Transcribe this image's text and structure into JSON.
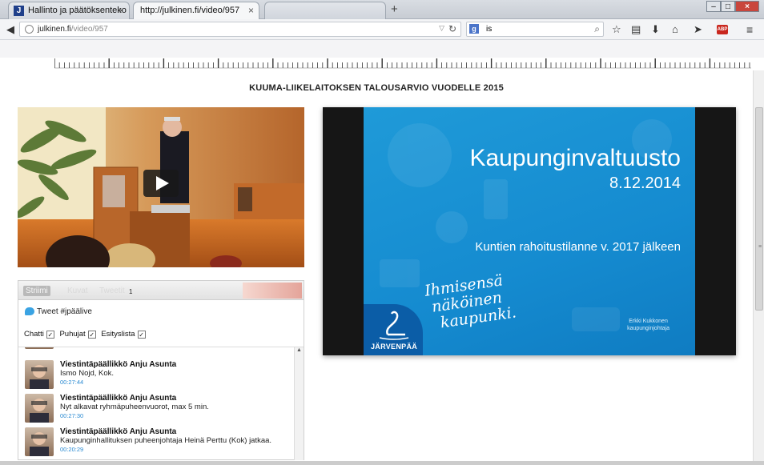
{
  "browser": {
    "tabs": [
      {
        "label": "Hallinto ja päätöksenteko -...",
        "favicon": "J"
      },
      {
        "label": "http://julkinen.fi/video/957"
      },
      {
        "label": ""
      }
    ],
    "new_tab": "+",
    "url_domain": "julkinen.fi",
    "url_path": "/video/957",
    "search_value": "is",
    "search_engine": "g"
  },
  "page": {
    "title": "KUUMA-LIIKELAITOKSEN TALOUSARVIO VUODELLE 2015"
  },
  "slide": {
    "title": "Kaupunginvaltuusto",
    "date": "8.12.2014",
    "subtitle": "Kuntien rahoitustilanne v. 2017 jälkeen",
    "slogan_line1": "Ihmisensä",
    "slogan_line2": "näköinen",
    "slogan_line3": "kaupunki.",
    "logo_text": "JÄRVENPÄÄ",
    "presenter_name": "Erkki Kukkonen",
    "presenter_role": "kaupunginjohtaja"
  },
  "social": {
    "tabs": [
      "Striimi",
      "Kuvat",
      "Tweetit"
    ],
    "count": "1",
    "tweet_button": "Tweet #jpäälive",
    "filters": [
      {
        "label": "Chatti",
        "checked": true
      },
      {
        "label": "Puhujat",
        "checked": true
      },
      {
        "label": "Esityslista",
        "checked": true
      }
    ],
    "feed": [
      {
        "author": "Viestintäpäällikkö Anju Asunta",
        "message": "Ismo Nojd, Kok.",
        "time": "00:27:44"
      },
      {
        "author": "Viestintäpäällikkö Anju Asunta",
        "message": "Nyt alkavat ryhmäpuheenvuorot, max 5 min.",
        "time": "00:27:30"
      },
      {
        "author": "Viestintäpäällikkö Anju Asunta",
        "message": "Kaupunginhallituksen puheenjohtaja Heinä Perttu (Kok) jatkaa.",
        "time": "00:20:29"
      }
    ]
  },
  "colors": {
    "slide_blue": "#1a92d4",
    "timestamp": "#2a8ad2"
  }
}
